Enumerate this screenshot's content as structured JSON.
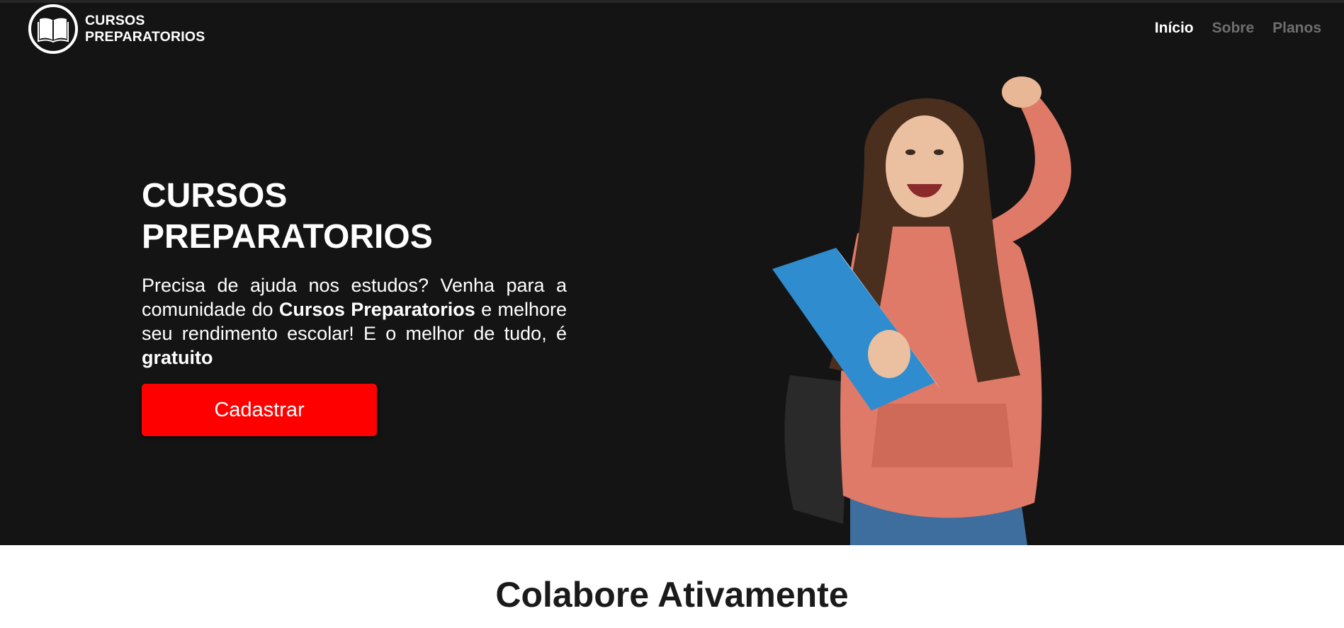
{
  "brand": {
    "line1": "CURSOS",
    "line2": "PREPARATORIOS",
    "logo_icon": "open-book-icon"
  },
  "nav": {
    "items": [
      {
        "label": "Início",
        "active": true
      },
      {
        "label": "Sobre",
        "active": false
      },
      {
        "label": "Planos",
        "active": false
      }
    ]
  },
  "hero": {
    "title_line1": "CURSOS",
    "title_line2": "PREPARATORIOS",
    "desc_part1": "Precisa de ajuda nos estudos? Venha para a comunidade do ",
    "desc_bold1": "Cursos Preparatorios",
    "desc_part2": " e melhore seu rendimento escolar! E o melhor de tudo, é ",
    "desc_bold2": "gratuito",
    "cta_label": "Cadastrar"
  },
  "section": {
    "title": "Colabore Ativamente"
  },
  "colors": {
    "hero_bg": "#141414",
    "cta_bg": "#ff0000",
    "nav_inactive": "#6e6e6e",
    "nav_active": "#ffffff"
  }
}
